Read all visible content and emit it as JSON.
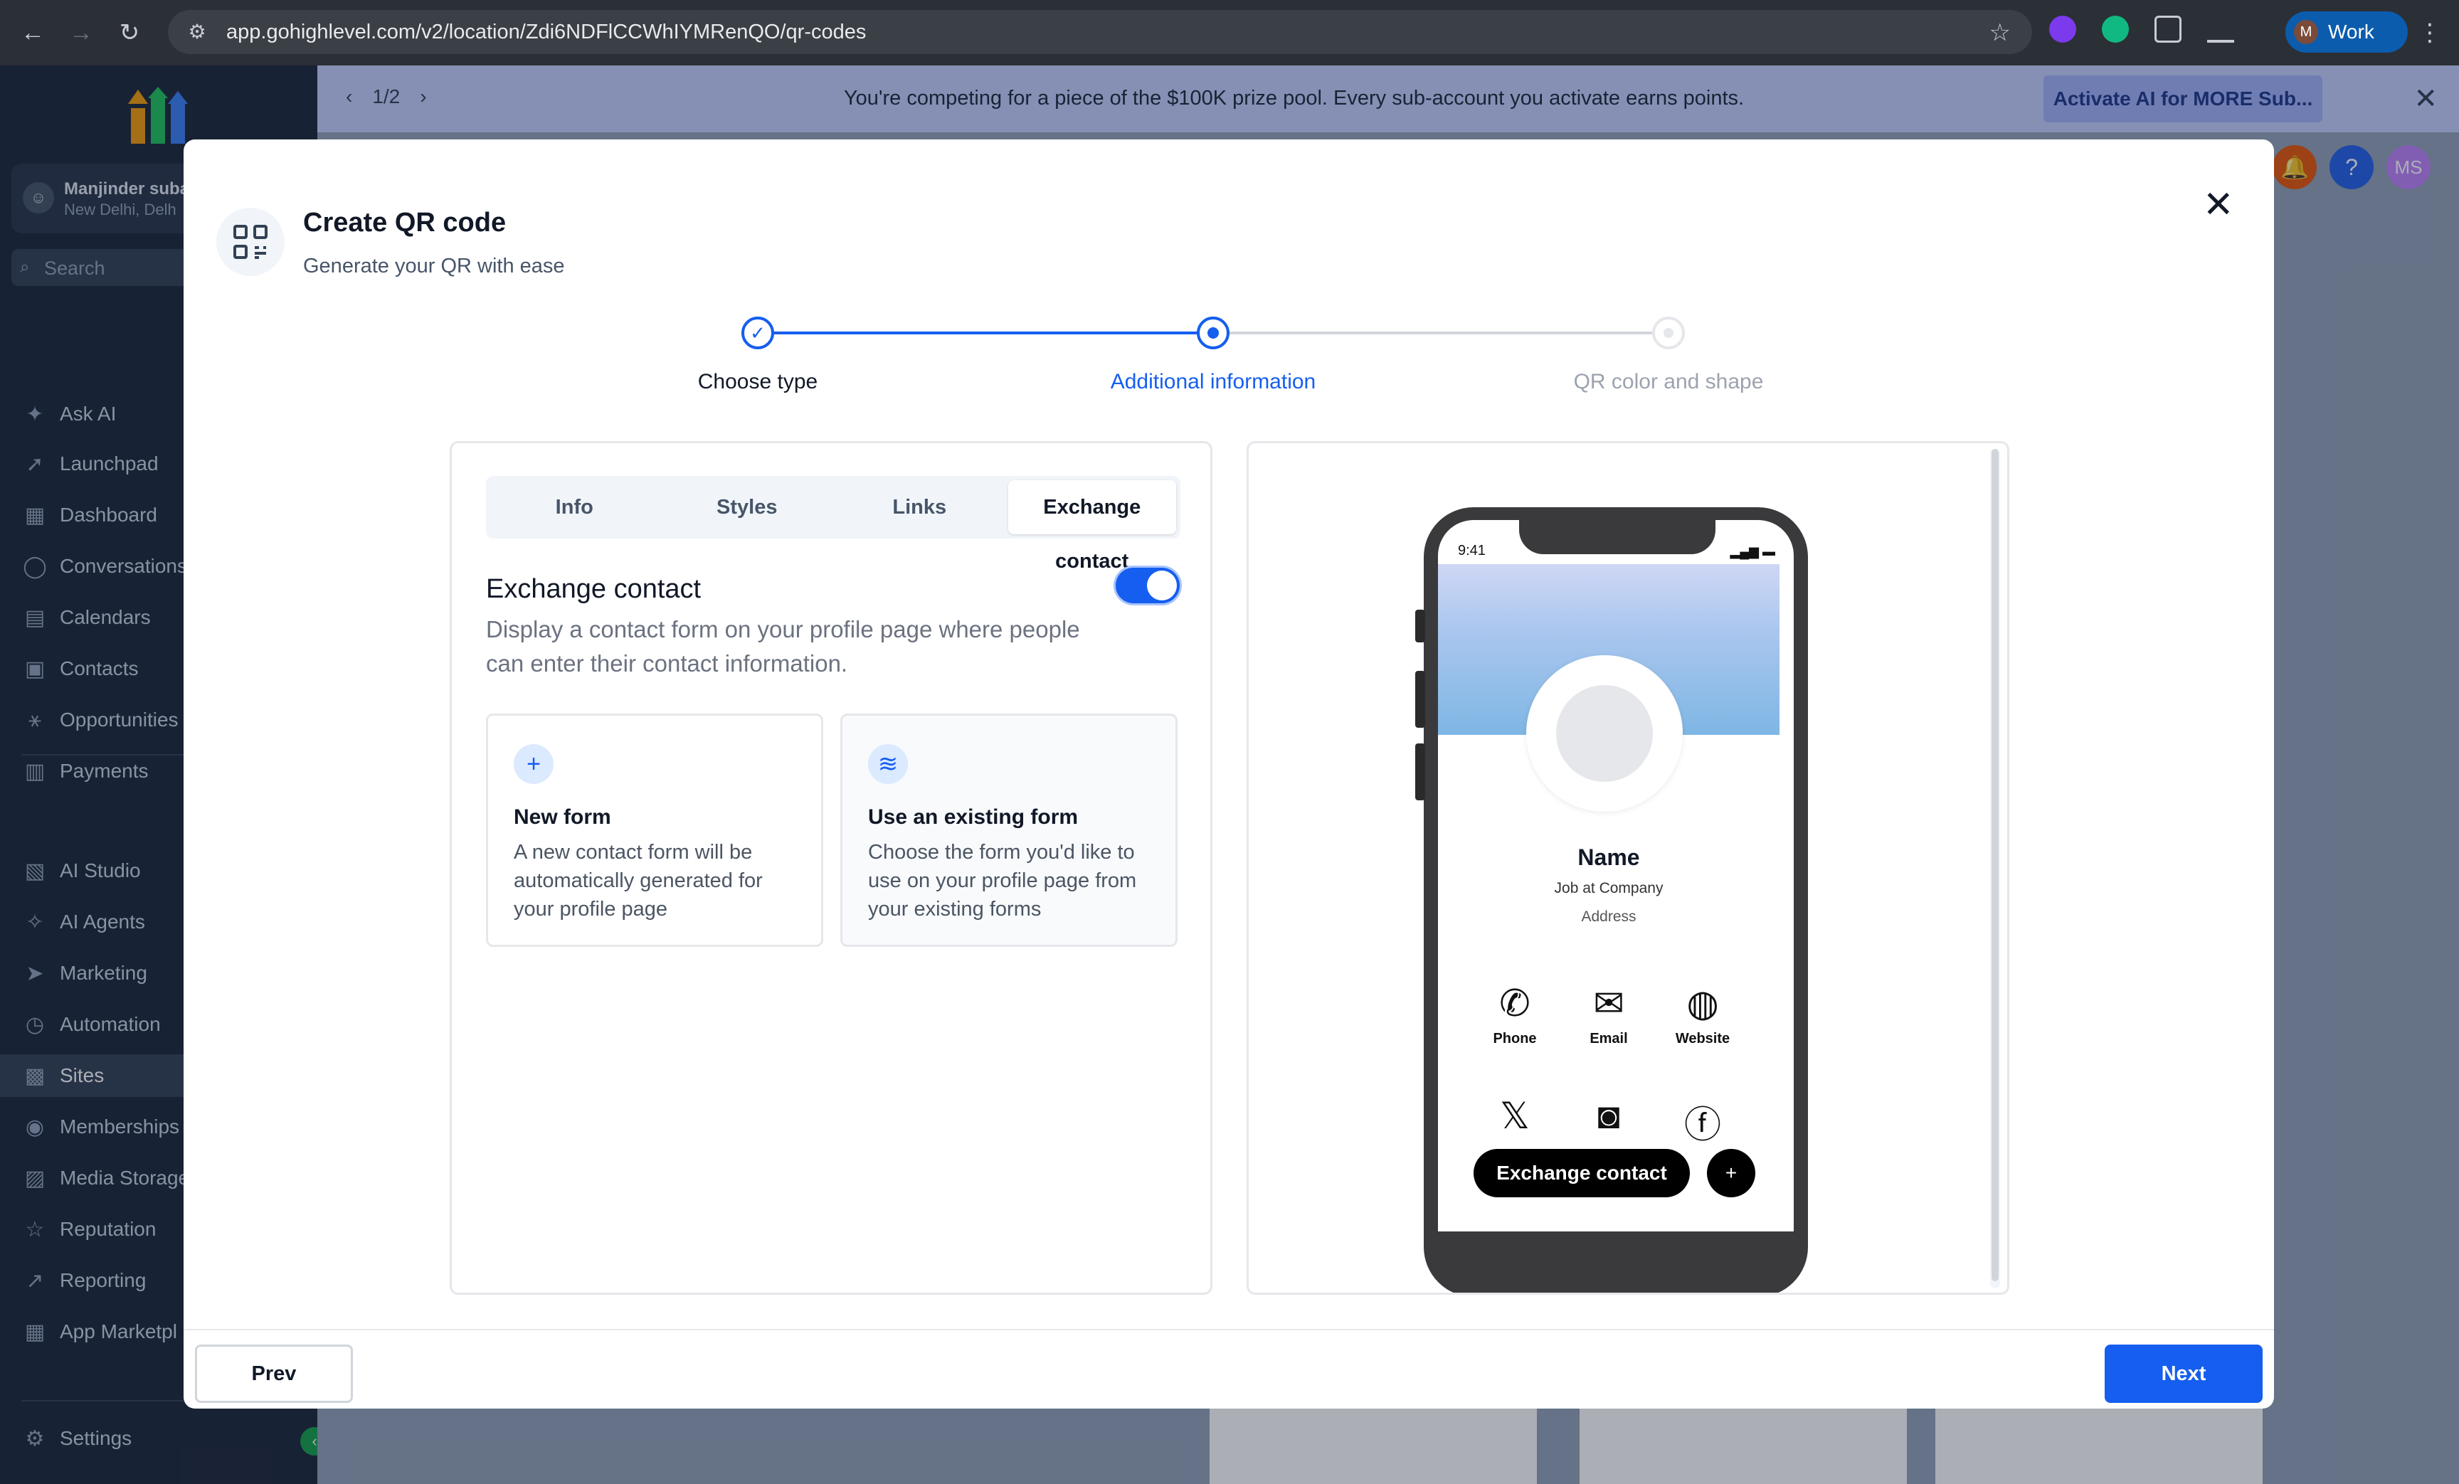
{
  "browser": {
    "url": "app.gohighlevel.com/v2/location/Zdi6NDFlCCWhIYMRenQO/qr-codes",
    "profile_label": "Work",
    "profile_initial": "M"
  },
  "sidebar": {
    "account_name": "Manjinder suba",
    "account_location": "New Delhi, Delh",
    "search_placeholder": "Search",
    "items": [
      {
        "label": "Ask AI",
        "icon": "sparkle-icon"
      },
      {
        "label": "Launchpad",
        "icon": "rocket-icon"
      },
      {
        "label": "Dashboard",
        "icon": "grid-icon"
      },
      {
        "label": "Conversations",
        "icon": "chat-icon"
      },
      {
        "label": "Calendars",
        "icon": "calendar-icon"
      },
      {
        "label": "Contacts",
        "icon": "contacts-icon"
      },
      {
        "label": "Opportunities",
        "icon": "opportunities-icon"
      },
      {
        "label": "Payments",
        "icon": "payments-icon"
      },
      {
        "label": "AI Studio",
        "icon": "ai-studio-icon"
      },
      {
        "label": "AI Agents",
        "icon": "ai-agents-icon"
      },
      {
        "label": "Marketing",
        "icon": "send-icon"
      },
      {
        "label": "Automation",
        "icon": "automation-icon"
      },
      {
        "label": "Sites",
        "icon": "sites-icon"
      },
      {
        "label": "Memberships",
        "icon": "memberships-icon"
      },
      {
        "label": "Media Storage",
        "icon": "media-icon"
      },
      {
        "label": "Reputation",
        "icon": "star-icon"
      },
      {
        "label": "Reporting",
        "icon": "reporting-icon"
      },
      {
        "label": "App Marketpl",
        "icon": "apps-icon"
      }
    ],
    "settings_label": "Settings"
  },
  "banner": {
    "pager": "1/2",
    "message": "You're competing for a piece of the $100K prize pool. Every sub-account you activate earns points.",
    "cta": "Activate AI for MORE Sub..."
  },
  "header_avatar": "MS",
  "modal": {
    "title": "Create QR code",
    "subtitle": "Generate your QR with ease",
    "steps": [
      {
        "label": "Choose type",
        "state": "done"
      },
      {
        "label": "Additional information",
        "state": "current"
      },
      {
        "label": "QR color and shape",
        "state": "todo"
      }
    ],
    "tabs": [
      "Info",
      "Styles",
      "Links",
      "Exchange contact"
    ],
    "active_tab": "Exchange contact",
    "section": {
      "title": "Exchange contact",
      "description": "Display a contact form on your profile page where people can enter their contact information.",
      "toggle_on": true
    },
    "cards": [
      {
        "title": "New form",
        "description": "A new contact form will be automatically generated for your profile page",
        "icon": "plus-icon"
      },
      {
        "title": "Use an existing form",
        "description": "Choose the form you'd like to use on your profile page from your existing forms",
        "icon": "layers-icon"
      }
    ],
    "preview": {
      "time": "9:41",
      "name": "Name",
      "job": "Job at Company",
      "address": "Address",
      "actions": [
        "Phone",
        "Email",
        "Website"
      ],
      "socials": [
        "x-icon",
        "instagram-icon",
        "facebook-icon"
      ],
      "exchange_button": "Exchange contact"
    },
    "prev_label": "Prev",
    "next_label": "Next"
  },
  "colors": {
    "primary": "#155eef",
    "sidebar_bg": "#1e293b",
    "banner_bg": "#c7d2fe"
  }
}
